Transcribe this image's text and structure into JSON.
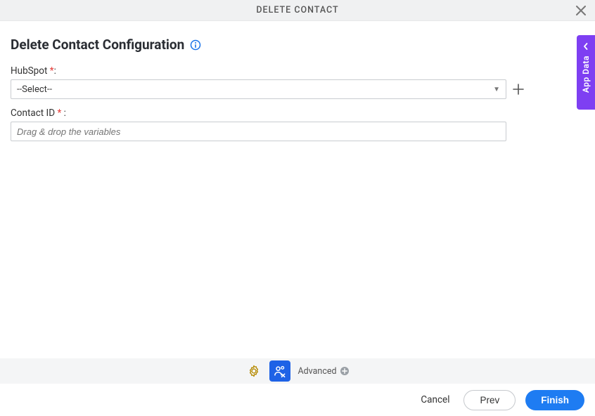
{
  "header": {
    "title": "DELETE CONTACT"
  },
  "page": {
    "title": "Delete Contact Configuration"
  },
  "form": {
    "hubspot": {
      "label": "HubSpot",
      "required_marker": "*",
      "colon": ":",
      "selected": "--Select--"
    },
    "contact_id": {
      "label": "Contact ID",
      "required_marker": "*",
      "colon": ":",
      "placeholder": "Drag & drop the variables"
    }
  },
  "side_panel": {
    "label": "App Data"
  },
  "toolbar": {
    "advanced_label": "Advanced"
  },
  "footer": {
    "cancel": "Cancel",
    "prev": "Prev",
    "finish": "Finish"
  }
}
